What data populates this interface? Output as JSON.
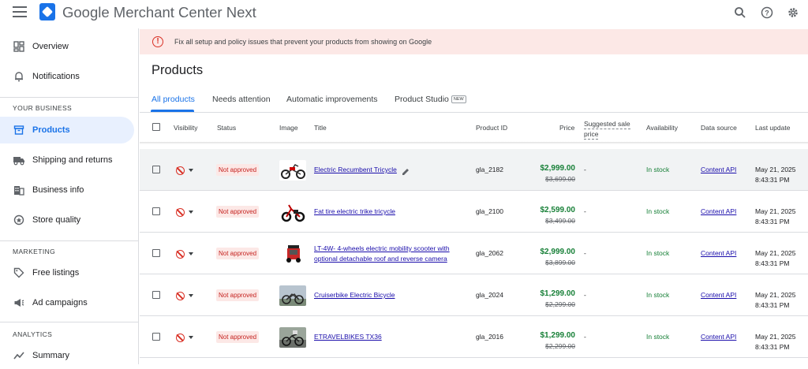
{
  "app": {
    "title": "Google Merchant Center Next"
  },
  "sidebar": {
    "items": [
      {
        "label": "Overview",
        "icon": "dashboard-icon"
      },
      {
        "label": "Notifications",
        "icon": "bell-icon"
      },
      {
        "label": "Products",
        "icon": "box-icon",
        "active": true
      },
      {
        "label": "Shipping and returns",
        "icon": "truck-icon"
      },
      {
        "label": "Business info",
        "icon": "building-icon"
      },
      {
        "label": "Store quality",
        "icon": "store-quality-icon"
      },
      {
        "label": "Free listings",
        "icon": "tag-icon"
      },
      {
        "label": "Ad campaigns",
        "icon": "megaphone-icon"
      },
      {
        "label": "Summary",
        "icon": "trend-icon"
      }
    ],
    "sections": {
      "business": "YOUR BUSINESS",
      "marketing": "MARKETING",
      "analytics": "ANALYTICS"
    }
  },
  "banner": {
    "text": "Fix all setup and policy issues that prevent your products from showing on Google"
  },
  "page": {
    "title": "Products"
  },
  "tabs": [
    {
      "label": "All products",
      "active": true
    },
    {
      "label": "Needs attention"
    },
    {
      "label": "Automatic improvements"
    },
    {
      "label": "Product Studio",
      "badge": "NEW"
    }
  ],
  "table": {
    "headers": {
      "visibility": "Visibility",
      "status": "Status",
      "image": "Image",
      "title": "Title",
      "product_id": "Product ID",
      "price": "Price",
      "suggested_line1": "Suggested sale",
      "suggested_line2": "price",
      "availability": "Availability",
      "data_source": "Data source",
      "last_update": "Last update"
    },
    "rows": [
      {
        "status": "Not approved",
        "title_line1": "Electric Recumbent Tricycle",
        "title_line2": "",
        "product_id": "gla_2182",
        "price": "$2,999.00",
        "old_price": "$3,699.00",
        "suggested": "-",
        "availability": "In stock",
        "data_source": "Content API",
        "date": "May 21, 2025",
        "time": "8:43:31 PM"
      },
      {
        "status": "Not approved",
        "title_line1": "Fat tire electric trike tricycle",
        "title_line2": "",
        "product_id": "gla_2100",
        "price": "$2,599.00",
        "old_price": "$3,499.00",
        "suggested": "-",
        "availability": "In stock",
        "data_source": "Content API",
        "date": "May 21, 2025",
        "time": "8:43:31 PM"
      },
      {
        "status": "Not approved",
        "title_line1": "LT-4W- 4-wheels electric mobility scooter with",
        "title_line2": "optional detachable roof and reverse camera",
        "product_id": "gla_2062",
        "price": "$2,999.00",
        "old_price": "$3,899.00",
        "suggested": "-",
        "availability": "In stock",
        "data_source": "Content API",
        "date": "May 21, 2025",
        "time": "8:43:31 PM"
      },
      {
        "status": "Not approved",
        "title_line1": "Cruiserbike Electric Bicycle",
        "title_line2": "",
        "product_id": "gla_2024",
        "price": "$1,299.00",
        "old_price": "$2,299.00",
        "suggested": "-",
        "availability": "In stock",
        "data_source": "Content API",
        "date": "May 21, 2025",
        "time": "8:43:31 PM"
      },
      {
        "status": "Not approved",
        "title_line1": "ETRAVELBIKES TX36",
        "title_line2": "",
        "product_id": "gla_2016",
        "price": "$1,299.00",
        "old_price": "$2,299.00",
        "suggested": "-",
        "availability": "In stock",
        "data_source": "Content API",
        "date": "May 21, 2025",
        "time": "8:43:31 PM"
      }
    ]
  },
  "colors": {
    "accent": "#1a73e8",
    "price_green": "#188038",
    "error_red": "#d93025",
    "banner_bg": "#fce8e6"
  }
}
